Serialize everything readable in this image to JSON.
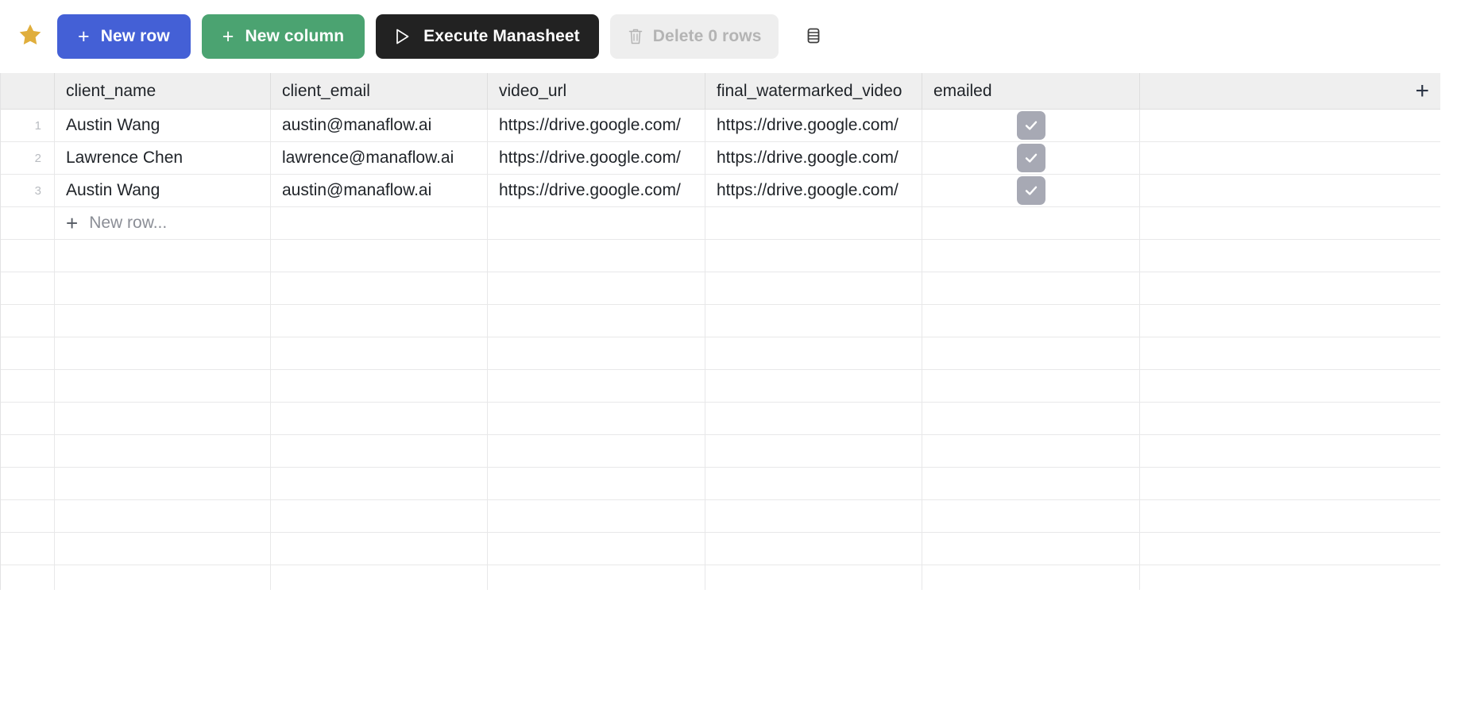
{
  "toolbar": {
    "star_icon": "star-icon",
    "new_row_label": "New row",
    "new_row_plus": "+",
    "new_column_label": "New column",
    "new_column_plus": "+",
    "execute_label": "Execute Manasheet",
    "execute_icon": "play-icon",
    "delete_label": "Delete 0 rows",
    "delete_icon": "trash-icon",
    "rows_view_icon": "rows-view-icon",
    "colors": {
      "new_row": "#4460d6",
      "new_column": "#4ba371",
      "execute": "#222222",
      "delete_bg": "#eeeeee",
      "delete_text": "#b4b4b4",
      "star": "#e0ae3c"
    }
  },
  "table": {
    "columns": [
      {
        "key": "rownum",
        "label": ""
      },
      {
        "key": "client_name",
        "label": "client_name"
      },
      {
        "key": "client_email",
        "label": "client_email"
      },
      {
        "key": "video_url",
        "label": "video_url"
      },
      {
        "key": "final_watermarked_video",
        "label": "final_watermarked_video"
      },
      {
        "key": "emailed",
        "label": "emailed"
      },
      {
        "key": "tail",
        "label": ""
      }
    ],
    "add_column_label": "+",
    "rows": [
      {
        "num": "1",
        "client_name": "Austin Wang",
        "client_email": "austin@manaflow.ai",
        "video_url": "https://drive.google.com/",
        "final_watermarked_video": "https://drive.google.com/",
        "emailed": true
      },
      {
        "num": "2",
        "client_name": "Lawrence Chen",
        "client_email": "lawrence@manaflow.ai",
        "video_url": "https://drive.google.com/",
        "final_watermarked_video": "https://drive.google.com/",
        "emailed": true
      },
      {
        "num": "3",
        "client_name": "Austin Wang",
        "client_email": "austin@manaflow.ai",
        "video_url": "https://drive.google.com/",
        "final_watermarked_video": "https://drive.google.com/",
        "emailed": true
      }
    ],
    "new_row_label": "New row...",
    "new_row_plus": "+",
    "empty_row_count": 11
  }
}
